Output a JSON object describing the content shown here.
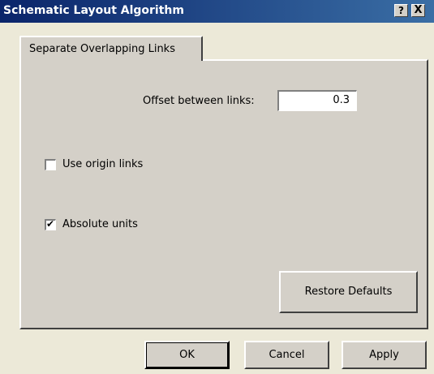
{
  "window": {
    "title": "Schematic Layout Algorithm",
    "help_glyph": "?",
    "close_glyph": "X"
  },
  "tabs": [
    {
      "label": "Separate Overlapping Links",
      "selected": true
    }
  ],
  "panel": {
    "offset_label": "Offset between links:",
    "offset_value": "0.3",
    "use_origin_links": {
      "label": "Use origin links",
      "checked": false
    },
    "absolute_units": {
      "label": "Absolute units",
      "checked": true,
      "check_glyph": "✔"
    },
    "restore_defaults_label": "Restore Defaults"
  },
  "footer": {
    "ok_label": "OK",
    "cancel_label": "Cancel",
    "apply_label": "Apply"
  },
  "colors": {
    "dialog_face": "#d4d0c8",
    "titlebar_start": "#0a246a",
    "titlebar_end": "#3a6ea5"
  }
}
